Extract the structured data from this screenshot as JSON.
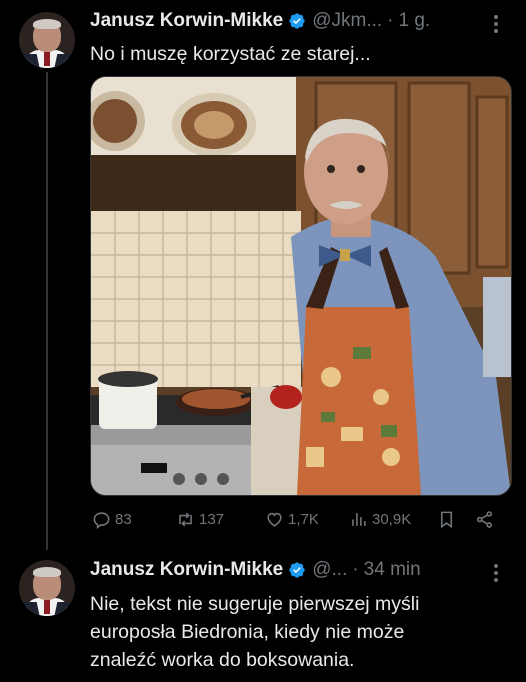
{
  "tweet1": {
    "author_name": "Janusz Korwin-Mikke",
    "handle": "@Jkm...",
    "separator": "·",
    "time": "1 g.",
    "text": "No i muszę korzystać ze starej...",
    "verified_color": "#1d9bf0",
    "stats": {
      "replies": "83",
      "reposts": "137",
      "likes": "1,7K",
      "views": "30,9K"
    }
  },
  "tweet2": {
    "author_name": "Janusz Korwin-Mikke",
    "handle": "@...",
    "separator": "·",
    "time": "34 min",
    "text_lines": [
      "Nie, tekst nie sugeruje pierwszej myśli",
      "europosła Biedronia, kiedy nie może",
      "znaleźć worka do boksowania."
    ]
  },
  "icons": [
    "reply-icon",
    "repost-icon",
    "like-icon",
    "views-icon",
    "bookmark-icon",
    "share-icon",
    "more-icon",
    "verified-icon"
  ]
}
